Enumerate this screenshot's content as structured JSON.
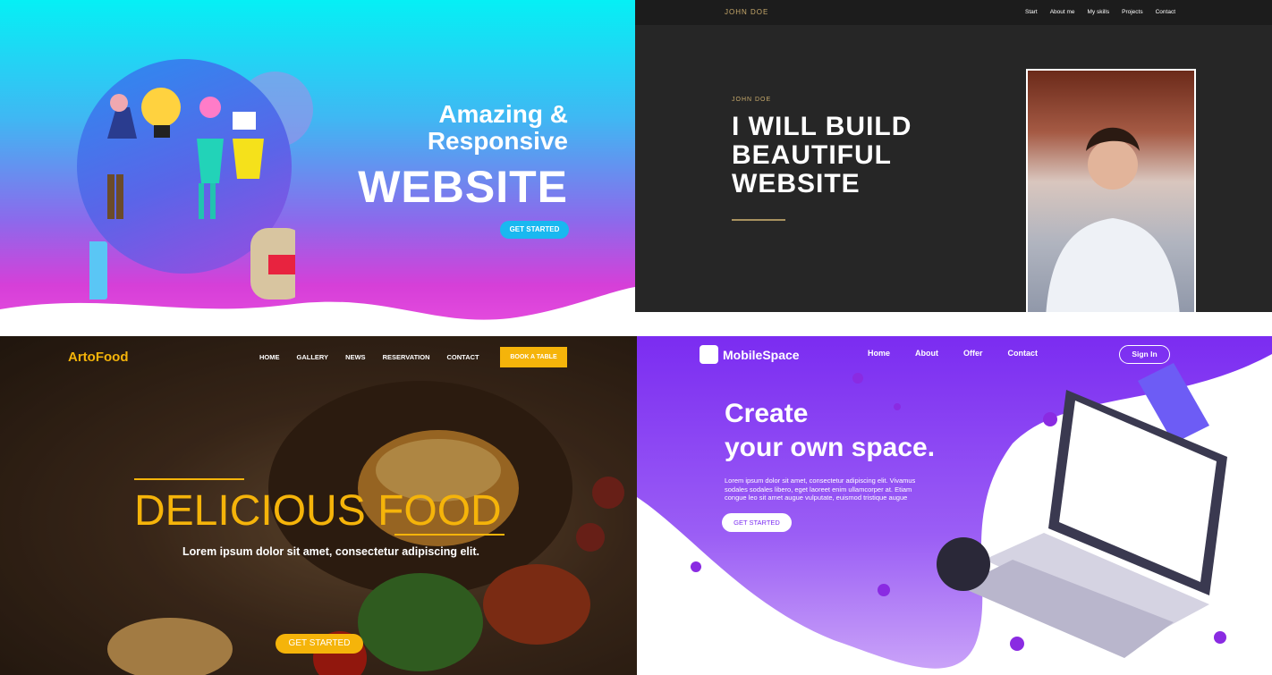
{
  "panels": {
    "agency": {
      "headline_line1": "Amazing &",
      "headline_line2": "Responsive",
      "headline_line3": "WEBSITE",
      "cta": "GET STARTED",
      "colors": {
        "gradient_top": "#05f0f5",
        "gradient_bottom": "#e94fe0",
        "button": "#19b8f0"
      }
    },
    "portfolio": {
      "brand": "JOHN DOE",
      "nav": [
        "Start",
        "About me",
        "My skills",
        "Projects",
        "Contact"
      ],
      "subtitle": "JOHN DOE",
      "headline": [
        "I WILL BUILD",
        "BEAUTIFUL",
        "WEBSITE"
      ],
      "colors": {
        "accent": "#c7a96b",
        "background": "#262626"
      }
    },
    "restaurant": {
      "brand": "ArtoFood",
      "nav": [
        "HOME",
        "GALLERY",
        "NEWS",
        "RESERVATION",
        "CONTACT"
      ],
      "book_button": "BOOK A TABLE",
      "title": "DELICIOUS FOOD",
      "tagline": "Lorem ipsum dolor sit amet, consectetur adipiscing elit.",
      "cta": "GET STARTED",
      "colors": {
        "accent": "#f5b40a"
      }
    },
    "mobilespace": {
      "brand": "MobileSpace",
      "nav": [
        "Home",
        "About",
        "Offer",
        "Contact"
      ],
      "signin": "Sign In",
      "headline_line1": "Create",
      "headline_line2": "your own space.",
      "body": "Lorem ipsum dolor sit amet, consectetur adipiscing elit. Vivamus sodales sodales libero, eget laoreet enim ullamcorper at. Etiam congue leo sit amet augue vulputate, euismod tristique augue",
      "cta": "GET STARTED",
      "colors": {
        "primary": "#7b2cf1",
        "light": "#b07af7"
      }
    }
  }
}
